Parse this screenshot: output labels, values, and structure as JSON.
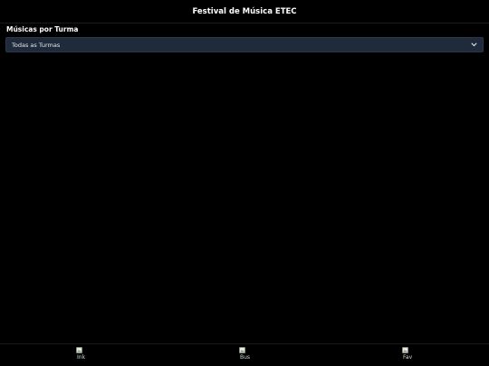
{
  "header": {
    "title": "Festival de Música ETEC"
  },
  "main": {
    "section_title": "Músicas por Turma",
    "filter": {
      "selected": "Todas as Turmas"
    }
  },
  "footer": {
    "nav": [
      {
        "alt": "Ink",
        "icon": "broken-image-icon"
      },
      {
        "alt": "Bus",
        "icon": "broken-image-icon"
      },
      {
        "alt": "Fav",
        "icon": "broken-image-icon"
      }
    ]
  },
  "colors": {
    "background": "#000000",
    "select_bg": "#1f2a3a",
    "text": "#ffffff"
  }
}
